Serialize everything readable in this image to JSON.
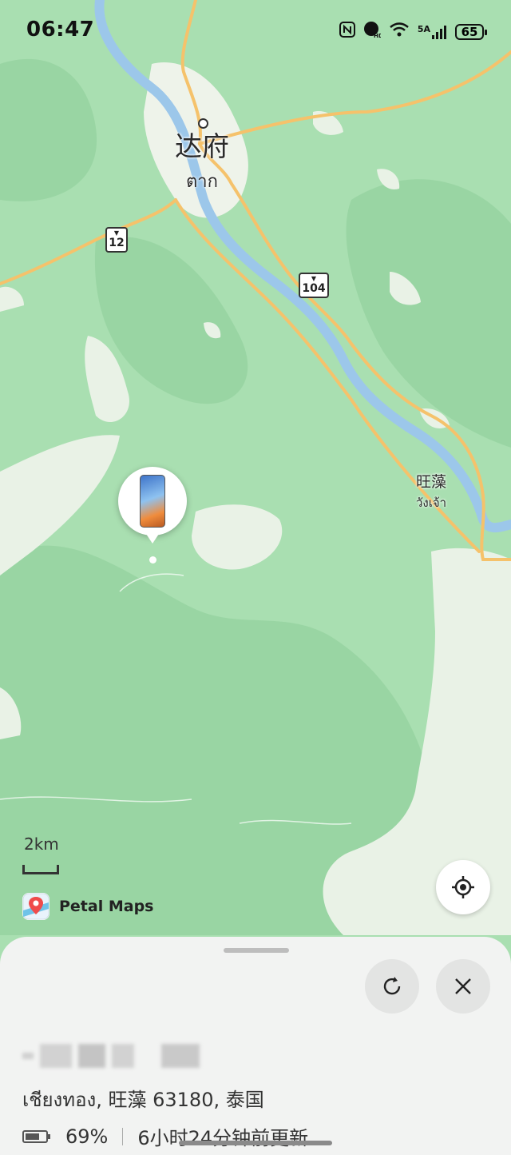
{
  "status_bar": {
    "time": "06:47",
    "icons": [
      "nfc-icon",
      "hd-call-icon",
      "wifi-icon",
      "cellular-5a-icon"
    ],
    "network_label": "5A",
    "battery_level": "65"
  },
  "map": {
    "cities": [
      {
        "name_cn": "达府",
        "name_th": "ตาก"
      },
      {
        "name_cn": "旺藻",
        "name_th": "วังเจ้า"
      }
    ],
    "routes": [
      "12",
      "104"
    ],
    "scale_label": "2km",
    "brand": "Petal Maps"
  },
  "device_card": {
    "address": "เชียงทอง, 旺藻 63180, 泰国",
    "battery_percent": "69%",
    "last_update": "6小时24分钟前更新"
  },
  "colors": {
    "forest": "#a9dfb1",
    "forest_dark": "#8ccf98",
    "road": "#f5c26b",
    "river": "#9cc7ea",
    "urban": "#eef3ea"
  }
}
